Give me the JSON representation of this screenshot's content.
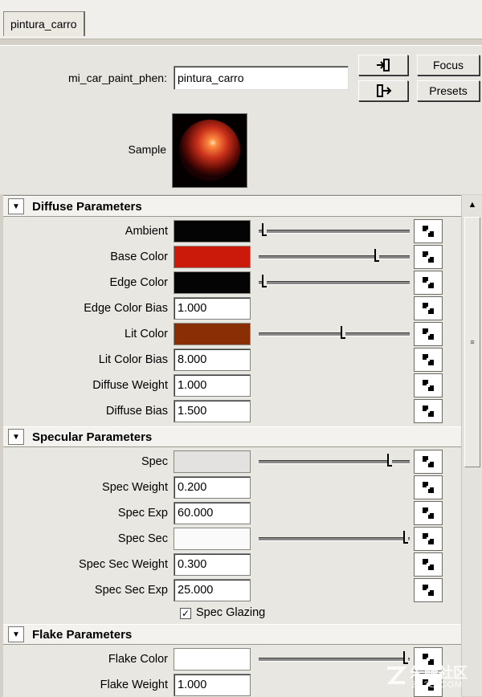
{
  "tab": {
    "label": "pintura_carro"
  },
  "header": {
    "node_type_label": "mi_car_paint_phen:",
    "node_name_value": "pintura_carro",
    "focus_label": "Focus",
    "presets_label": "Presets",
    "sample_label": "Sample"
  },
  "sections": {
    "diffuse": {
      "title": "Diffuse Parameters",
      "rows": [
        {
          "label": "Ambient",
          "color": "#050404",
          "slider": 0.02
        },
        {
          "label": "Base Color",
          "color": "#cc1a0a",
          "slider": 0.79
        },
        {
          "label": "Edge Color",
          "color": "#050404",
          "slider": 0.02
        },
        {
          "label": "Edge Color Bias",
          "value": "1.000"
        },
        {
          "label": "Lit Color",
          "color": "#8a2e05",
          "slider": 0.56
        },
        {
          "label": "Lit Color Bias",
          "value": "8.000"
        },
        {
          "label": "Diffuse Weight",
          "value": "1.000"
        },
        {
          "label": "Diffuse Bias",
          "value": "1.500"
        }
      ]
    },
    "specular": {
      "title": "Specular Parameters",
      "rows": [
        {
          "label": "Spec",
          "color": "#e3e2e0",
          "slider": 0.88
        },
        {
          "label": "Spec Weight",
          "value": "0.200"
        },
        {
          "label": "Spec Exp",
          "value": "60.000"
        },
        {
          "label": "Spec Sec",
          "color": "#fafafa",
          "slider": 0.99
        },
        {
          "label": "Spec Sec Weight",
          "value": "0.300"
        },
        {
          "label": "Spec Sec Exp",
          "value": "25.000"
        }
      ],
      "checkbox": {
        "label": "Spec Glazing",
        "checked": true
      }
    },
    "flake": {
      "title": "Flake Parameters",
      "rows": [
        {
          "label": "Flake Color",
          "color": "#ffffff",
          "slider": 0.99
        },
        {
          "label": "Flake Weight",
          "value": "1.000"
        }
      ]
    }
  },
  "watermark": {
    "text": "朱峰社区",
    "subtext": "ZF3D.COM"
  }
}
